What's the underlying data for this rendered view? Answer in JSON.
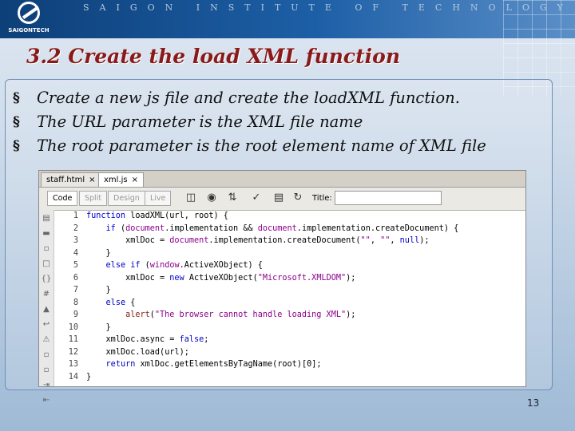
{
  "header": {
    "logo_text": "SAIGONTECH",
    "institute": "SAIGON INSTITUTE OF TECHNOLOGY"
  },
  "slide": {
    "title": "3.2 Create the load XML function",
    "bullets": [
      "Create a new js file and create the loadXML function.",
      "The URL parameter is the XML file name",
      "The root parameter is the root element name of XML file"
    ],
    "page_number": "13"
  },
  "editor": {
    "tabs": [
      "staff.html",
      "xml.js"
    ],
    "tab_close": "×",
    "view_buttons": [
      "Code",
      "Split",
      "Design",
      "Live"
    ],
    "title_label": "Title:",
    "title_value": "",
    "toolbar_icons": [
      "multiscreen-icon",
      "globe-icon",
      "debug-icon",
      "validate-icon",
      "file-manage-icon",
      "refresh-icon"
    ],
    "gutter_icons": [
      "open-document-icon",
      "collapse-icon",
      "expand-icon",
      "select-parent-icon",
      "balance-braces-icon",
      "line-numbers-icon",
      "highlight-icon",
      "wrap-icon",
      "syntax-error-icon",
      "comment-icon",
      "uncomment-icon",
      "indent-icon",
      "format-icon"
    ],
    "lines": [
      "function loadXML(url, root) {",
      "    if (document.implementation && document.implementation.createDocument) {",
      "        xmlDoc = document.implementation.createDocument(\"\", \"\", null);",
      "    }",
      "    else if (window.ActiveXObject) {",
      "        xmlDoc = new ActiveXObject(\"Microsoft.XMLDOM\");",
      "    }",
      "    else {",
      "        alert(\"The browser cannot handle loading XML\");",
      "    }",
      "    xmlDoc.async = false;",
      "    xmlDoc.load(url);",
      "    return xmlDoc.getElementsByTagName(root)[0];",
      "}"
    ]
  }
}
